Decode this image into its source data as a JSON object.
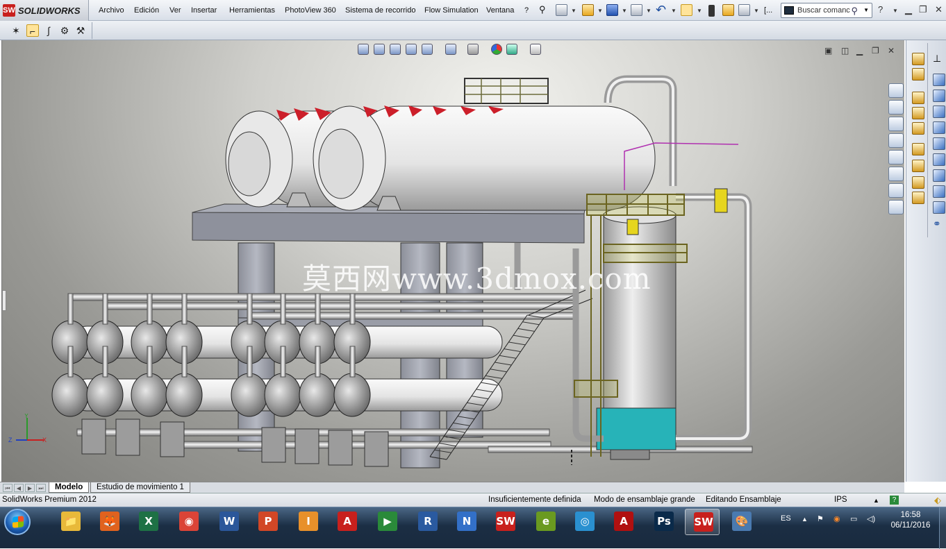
{
  "app": {
    "logo_text": "SOLIDWORKS",
    "logo_mark": "SW",
    "brand_color": "#c8201d"
  },
  "menu": {
    "items": [
      "Archivo",
      "Edición",
      "Ver",
      "Insertar",
      "Herramientas",
      "PhotoView 360",
      "Sistema de recorrido",
      "Flow Simulation",
      "Ventana",
      "?"
    ],
    "overflow": "[...",
    "search_placeholder": "Buscar comanc"
  },
  "toolbar2": {
    "icons": [
      "route-sketch-icon",
      "route-pipe-icon",
      "route-bend-icon",
      "route-flange-icon",
      "route-valve-icon"
    ]
  },
  "viewport": {
    "watermark": "莫西网www.3dmox.com",
    "triad": {
      "y": "Y",
      "x": "X",
      "z": "Z"
    },
    "background_top": "#f2f2ee",
    "background_bottom": "#7d7d79"
  },
  "tabs": {
    "items": [
      "Modelo",
      "Estudio de movimiento 1"
    ],
    "active": "Modelo"
  },
  "status": {
    "product": "SolidWorks Premium 2012",
    "definition": "Insuficientemente definida",
    "mode": "Modo de ensamblaje grande",
    "editing": "Editando Ensamblaje",
    "units": "IPS"
  },
  "taskbar": {
    "language": "ES",
    "time": "16:58",
    "date": "06/11/2016",
    "apps": [
      {
        "name": "explorer",
        "label": "📁",
        "color": "#e8b93a"
      },
      {
        "name": "firefox",
        "label": "🦊",
        "color": "#e0621e"
      },
      {
        "name": "excel",
        "label": "X",
        "color": "#1e7145"
      },
      {
        "name": "chrome",
        "label": "◉",
        "color": "#db4437"
      },
      {
        "name": "word",
        "label": "W",
        "color": "#2b579a"
      },
      {
        "name": "powerpoint",
        "label": "P",
        "color": "#d24726"
      },
      {
        "name": "inventor",
        "label": "I",
        "color": "#e8902a"
      },
      {
        "name": "autocad",
        "label": "A",
        "color": "#c8201d"
      },
      {
        "name": "project",
        "label": "▶",
        "color": "#2a8a3a"
      },
      {
        "name": "revit",
        "label": "R",
        "color": "#2a5aa0"
      },
      {
        "name": "navisworks",
        "label": "N",
        "color": "#3370c8"
      },
      {
        "name": "solidworks-a",
        "label": "SW",
        "color": "#c8201d"
      },
      {
        "name": "edrawings",
        "label": "e",
        "color": "#6a9a20"
      },
      {
        "name": "aperture",
        "label": "◎",
        "color": "#2a90d0"
      },
      {
        "name": "acrobat",
        "label": "A",
        "color": "#b01010"
      },
      {
        "name": "photoshop",
        "label": "Ps",
        "color": "#0a2a4a"
      },
      {
        "name": "solidworks-b",
        "label": "SW",
        "color": "#c8201d"
      },
      {
        "name": "paint",
        "label": "🎨",
        "color": "#4a7ab0"
      }
    ]
  }
}
